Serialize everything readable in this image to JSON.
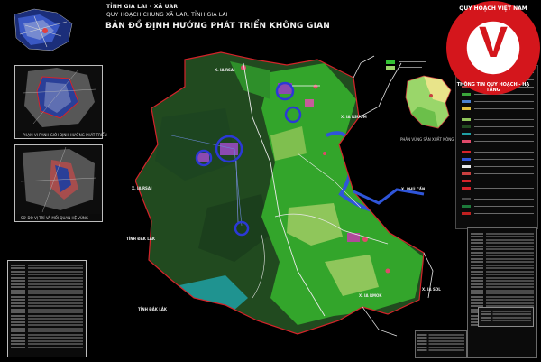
{
  "header": {
    "province_line": "TỈNH GIA LAI - XÃ UAR",
    "plan_line": "QUY HOẠCH CHUNG XÃ UAR, TỈNH GIA LAI",
    "map_title": "BẢN ĐỒ ĐỊNH HƯỚNG PHÁT TRIỂN KHÔNG GIAN"
  },
  "inset_captions": {
    "inset1": "PHẠM VI RANH GIỚI ĐỊNH HƯỚNG PHÁT TRIỂN",
    "inset2": "SƠ ĐỒ VỊ TRÍ VÀ MỐI QUAN HỆ VÙNG"
  },
  "map_labels": {
    "xa_top": "X. IA RSAI",
    "xa_upper_right": "X. IA RSƯƠM",
    "xa_left": "X. IA RSAI",
    "tinh_daklak_1": "TỈNH ĐẮK LẮK",
    "tinh_daklak_2": "TỈNH ĐẮK LẮK",
    "xa_right": "X. PHÚ CẦN",
    "xa_bottom": "X. IA RMOK",
    "xa_lower_right": "X. IA SOL"
  },
  "right_inset_caption": "PHÂN VÙNG SẢN XUẤT NÔNG NGHIỆP",
  "watermark": {
    "letter": "V",
    "top_text": "QUY HOẠCH VIỆT NAM",
    "bottom_text": "THÔNG TIN QUY HOẠCH - HẠ TẦNG"
  },
  "colors": {
    "background": "#000000",
    "forest_dark": "#214a1f",
    "forest_bright": "#33a52b",
    "agri_light": "#8fc65b",
    "water": "#2f55d9",
    "boundary": "#d5232a",
    "highlight_circle": "#2b39d6",
    "watermark_red": "#d4161c"
  }
}
